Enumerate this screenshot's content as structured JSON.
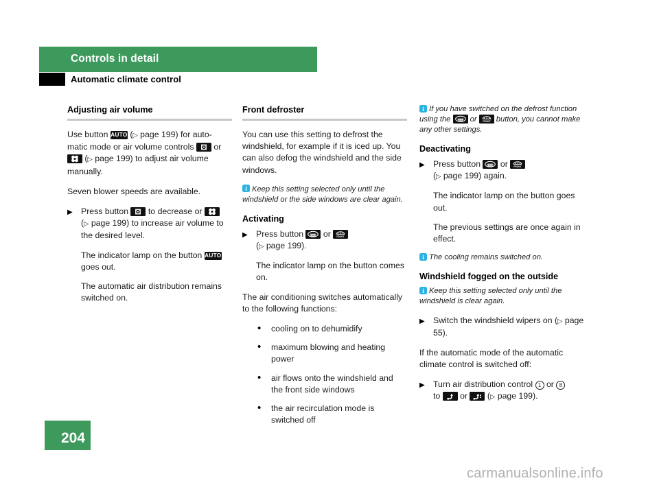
{
  "header": {
    "chapter": "Controls in detail",
    "section": "Automatic climate control"
  },
  "footer": {
    "page_number": "204",
    "watermark": "carmanualsonline.info"
  },
  "colors": {
    "brand_green": "#3d9a5c",
    "info_blue": "#2bb3e3",
    "icon_black": "#111111",
    "rule_gray": "#c8c8c8"
  },
  "icons": {
    "auto": "AUTO",
    "fan_small": "fan-low-icon",
    "fan_large": "fan-high-icon",
    "defroster_rear": "rear-defroster-icon",
    "defroster_front": "front-defroster-icon",
    "airflow_a": "airflow-footwell-icon",
    "airflow_b": "airflow-dash-footwell-icon",
    "info": "info-icon",
    "front_label": "FRONT"
  },
  "column_1": {
    "heading": "Adjusting air volume",
    "p1_a": "Use button",
    "p1_b": "(",
    "p1_c": "page 199) for auto-matic mode or air volume controls",
    "p1_d": "or",
    "p1_e": "(",
    "p1_f": "page 199) to adjust air volume manually.",
    "p2": "Seven blower speeds are available.",
    "step1_a": "Press button",
    "step1_b": "to decrease or",
    "step1_c": "(",
    "step1_d": "page 199) to increase air volume to the desired level.",
    "step1_sub_a": "The indicator lamp on the button",
    "step1_sub_b": "goes out.",
    "step1_sub2": "The automatic air distribution remains switched on."
  },
  "column_2": {
    "heading": "Front defroster",
    "p1": "You can use this setting to defrost the windshield, for example if it is iced up. You can also defog the windshield and the side windows.",
    "note1": "Keep this setting selected only until the windshield or the side windows are clear again.",
    "sub_activating": "Activating",
    "step1_a": "Press button",
    "step1_or": "or",
    "step1_b": "(",
    "step1_c": "page 199).",
    "step1_sub": "The indicator lamp on the button comes on.",
    "p2": "The air conditioning switches automatically to the following functions:",
    "bullets": [
      "cooling on to dehumidify",
      "maximum blowing and heating power",
      "air flows onto the windshield and the front side windows",
      "the air recirculation mode is switched off"
    ]
  },
  "column_3": {
    "note1_a": "If you have switched on the defrost function using the",
    "note1_or": "or",
    "note1_b": "button, you cannot make any other settings.",
    "sub_deactivating": "Deactivating",
    "step1_a": "Press button",
    "step1_or": "or",
    "step1_b": "(",
    "step1_c": "page 199) again.",
    "step1_sub1": "The indicator lamp on the button goes out.",
    "step1_sub2": "The previous settings are once again in effect.",
    "note2": "The cooling remains switched on.",
    "heading2": "Windshield fogged on the outside",
    "note3": "Keep this setting selected only until the windshield is clear again.",
    "step2_a": "Switch the windshield wipers on (",
    "step2_b": "page 55).",
    "p1": "If the automatic mode of the automatic climate control is switched off:",
    "step3_a": "Turn air distribution control",
    "step3_num1": "1",
    "step3_or1": "or",
    "step3_num2": "8",
    "step3_to": "to",
    "step3_or2": "or",
    "step3_b": "(",
    "step3_c": "page 199)."
  }
}
